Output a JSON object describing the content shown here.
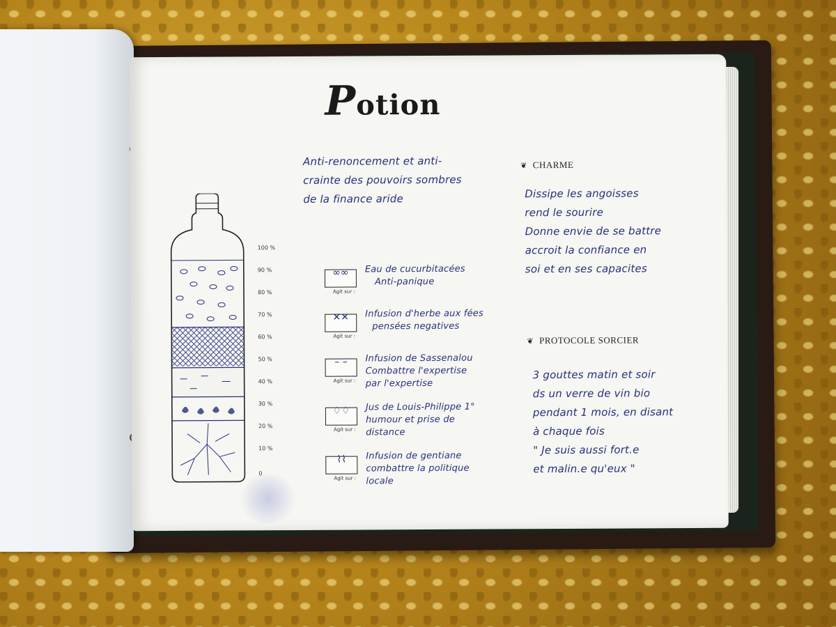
{
  "page": {
    "title_initial": "P",
    "title_rest": "otion",
    "intro": [
      "Anti-renoncement et anti-",
      "crainte des pouvoirs sombres",
      "de la finance aride"
    ],
    "charme": {
      "heading": "CHARME",
      "lines": [
        "Dissipe les angoisses",
        "rend le sourire",
        "Donne envie de se battre",
        "accroit la confiance en",
        "soi et en ses capacites"
      ]
    },
    "protocole": {
      "heading": "PROTOCOLE SORCIER",
      "lines": [
        "3 gouttes matin et soir",
        "ds un verre de vin bio",
        "pendant 1 mois, en disant",
        "à chaque fois",
        "\" Je suis aussi fort.e",
        "et malin.e qu'eux \""
      ]
    },
    "ingredients": [
      {
        "lines": [
          "Eau de cucurbitacées",
          "Anti-panique"
        ],
        "agit": "Agit sur :"
      },
      {
        "lines": [
          "Infusion d'herbe aux fées",
          "pensées negatives"
        ],
        "agit": "Agit sur :"
      },
      {
        "lines": [
          "Infusion de Sassenalou",
          "Combattre l'expertise",
          "par l'expertise"
        ],
        "agit": "Agit sur :"
      },
      {
        "lines": [
          "Jus de Louis-Philippe 1°",
          "humour et prise de",
          "distance"
        ],
        "agit": "Agit sur :"
      },
      {
        "lines": [
          "Infusion de gentiane",
          "combattre la politique",
          "locale"
        ],
        "agit": "Agit sur :"
      }
    ],
    "scale": [
      "100 %",
      "90 %",
      "80 %",
      "70 %",
      "60 %",
      "50 %",
      "40 %",
      "30 %",
      "20 %",
      "10 %",
      "0"
    ]
  }
}
